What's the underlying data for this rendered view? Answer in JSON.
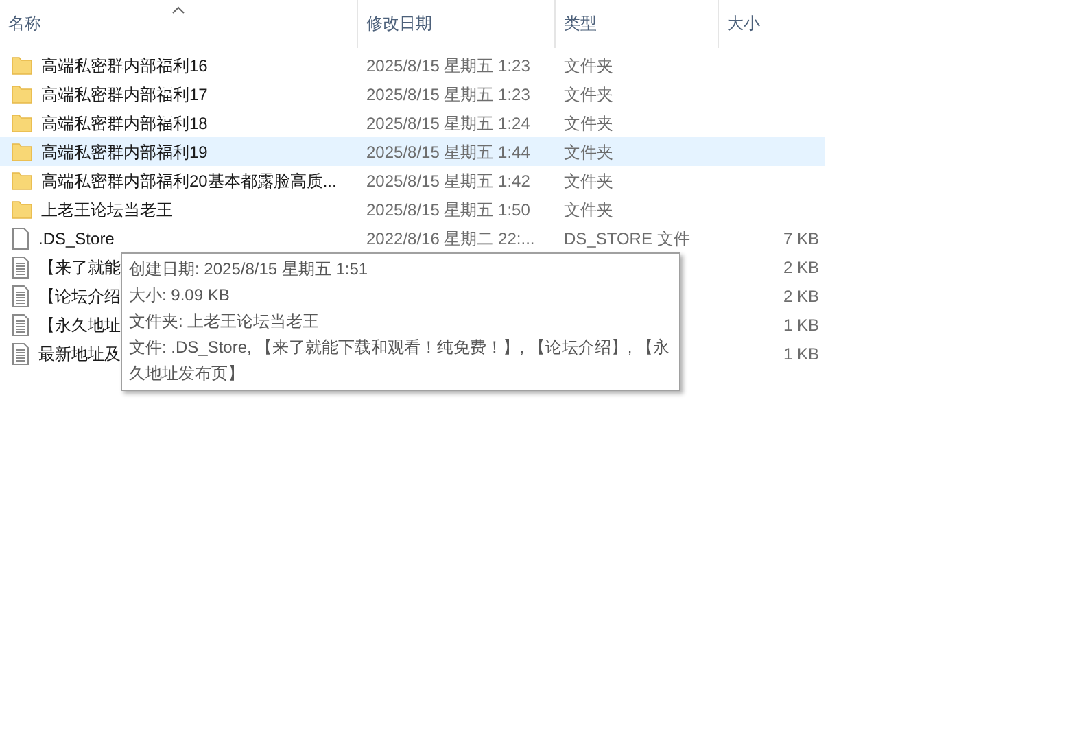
{
  "columns": [
    {
      "label": "名称",
      "sorted": true
    },
    {
      "label": "修改日期",
      "sorted": false
    },
    {
      "label": "类型",
      "sorted": false
    },
    {
      "label": "大小",
      "sorted": false
    }
  ],
  "rows": [
    {
      "kind": "folder",
      "name": "高端私密群内部福利16",
      "date": "2025/8/15 星期五 1:23",
      "type": "文件夹",
      "highlighted": false
    },
    {
      "kind": "folder",
      "name": "高端私密群内部福利17",
      "date": "2025/8/15 星期五 1:23",
      "type": "文件夹",
      "highlighted": false
    },
    {
      "kind": "folder",
      "name": "高端私密群内部福利18",
      "date": "2025/8/15 星期五 1:24",
      "type": "文件夹",
      "highlighted": false
    },
    {
      "kind": "folder",
      "name": "高端私密群内部福利19",
      "date": "2025/8/15 星期五 1:44",
      "type": "文件夹",
      "highlighted": true
    },
    {
      "kind": "folder",
      "name": "高端私密群内部福利20基本都露脸高质...",
      "date": "2025/8/15 星期五 1:42",
      "type": "文件夹",
      "highlighted": false
    },
    {
      "kind": "folder",
      "name": "上老王论坛当老王",
      "date": "2025/8/15 星期五 1:50",
      "type": "文件夹",
      "highlighted": false
    },
    {
      "kind": "file",
      "name": ".DS_Store",
      "date": "2022/8/16 星期二 22:...",
      "type": "DS_STORE 文件",
      "size": "7 KB",
      "highlighted": false
    },
    {
      "kind": "text",
      "name": "【来了就能",
      "size": "2 KB",
      "highlighted": false
    },
    {
      "kind": "text",
      "name": "【论坛介绍",
      "size": "2 KB",
      "highlighted": false
    },
    {
      "kind": "text",
      "name": "【永久地址",
      "size": "1 KB",
      "highlighted": false
    },
    {
      "kind": "text",
      "name": "最新地址及",
      "size": "1 KB",
      "highlighted": false
    }
  ],
  "tooltip": {
    "lines": [
      "创建日期: 2025/8/15 星期五 1:51",
      "大小: 9.09 KB",
      "文件夹: 上老王论坛当老王",
      "文件: .DS_Store, 【来了就能下载和观看！纯免费！】, 【论坛介绍】, 【永久地址发布页】"
    ]
  }
}
